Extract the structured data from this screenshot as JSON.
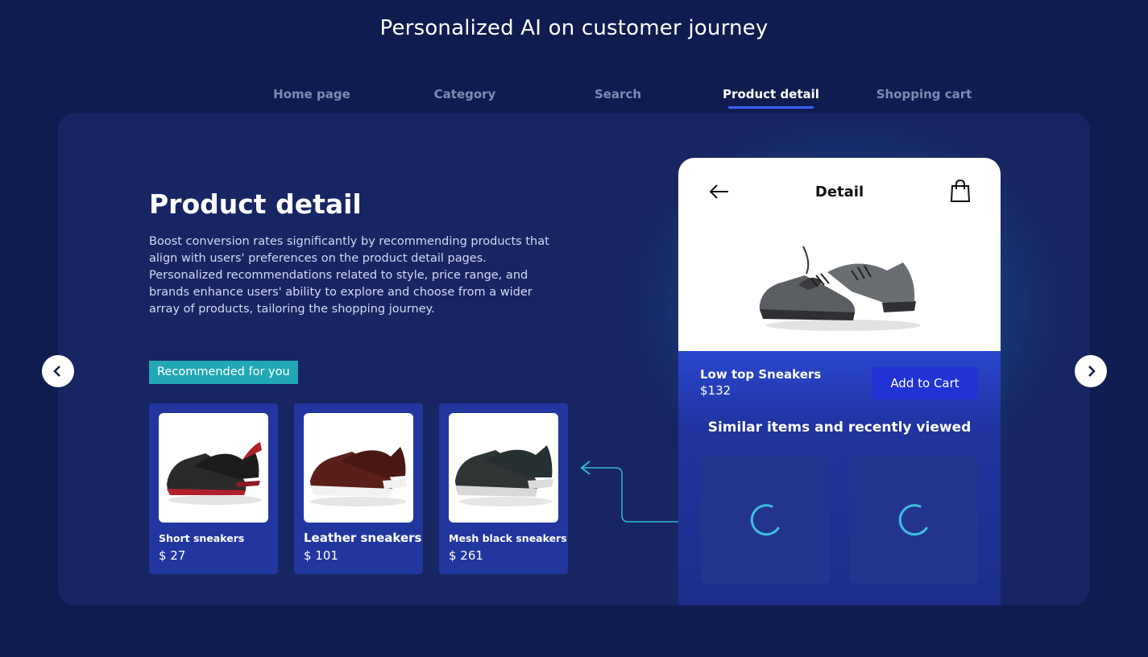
{
  "page": {
    "title": "Personalized AI on customer journey"
  },
  "tabs": [
    {
      "label": "Home page",
      "active": false
    },
    {
      "label": "Category",
      "active": false
    },
    {
      "label": "Search",
      "active": false
    },
    {
      "label": "Product detail",
      "active": true
    },
    {
      "label": "Shopping cart",
      "active": false
    }
  ],
  "content": {
    "heading": "Product detail",
    "description": "Boost conversion rates significantly by recommending products that align with users' preferences on the product detail pages. Personalized recommendations related to style, price range, and brands enhance users' ability to explore and choose from a wider array of products, tailoring the shopping journey.",
    "recommended_label": "Recommended for you",
    "recommendations": [
      {
        "name": "Short sneakers",
        "price": "$ 27"
      },
      {
        "name": "Leather sneakers",
        "price": "$ 101"
      },
      {
        "name": "Mesh black sneakers",
        "price": "$ 261"
      }
    ]
  },
  "phone": {
    "title": "Detail",
    "product_name": "Low top Sneakers",
    "product_price": "$132",
    "add_to_cart": "Add to Cart",
    "similar_title": "Similar items and recently viewed"
  },
  "icons": {
    "back": "arrow-left-icon",
    "bag": "shopping-bag-icon",
    "prev": "chevron-left-icon",
    "next": "chevron-right-icon",
    "loading": "spinner-icon"
  },
  "colors": {
    "background": "#0f1c4f",
    "panel": "#172563",
    "accent_tab": "#3a63ff",
    "badge": "#22a7b5",
    "button": "#2233d6",
    "card": "#2236a0"
  }
}
